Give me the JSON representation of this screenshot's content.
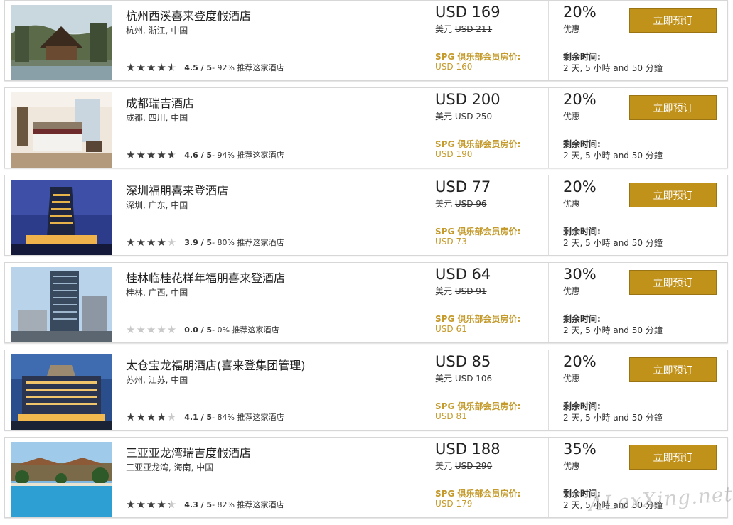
{
  "hotels": [
    {
      "name": "杭州西溪喜来登度假酒店",
      "location": "杭州, 浙江, 中国",
      "rating": 4.5,
      "rating_text": "4.5 / 5",
      "recommend_text": " - 92% 推荐这家酒店",
      "price": "USD 169",
      "old_prefix": "美元 ",
      "old_value": "USD 211",
      "spg_label": "SPG 俱乐部会员房价:",
      "spg_price": "USD 160",
      "discount": "20%",
      "discount_label": "优惠",
      "remaining_label": "剩余时间:",
      "remaining_value": "2 天, 5 小時 and 50 分鐘",
      "button": "立即预订",
      "thumb": "resort"
    },
    {
      "name": "成都瑞吉酒店",
      "location": "成都, 四川, 中国",
      "rating": 4.6,
      "rating_text": "4.6 / 5",
      "recommend_text": " - 94% 推荐这家酒店",
      "price": "USD 200",
      "old_prefix": "美元 ",
      "old_value": "USD 250",
      "spg_label": "SPG 俱乐部会员房价:",
      "spg_price": "USD 190",
      "discount": "20%",
      "discount_label": "优惠",
      "remaining_label": "剩余时间:",
      "remaining_value": "2 天, 5 小時 and 50 分鐘",
      "button": "立即预订",
      "thumb": "room"
    },
    {
      "name": "深圳福朋喜来登酒店",
      "location": "深圳, 广东, 中国",
      "rating": 3.9,
      "rating_text": "3.9 / 5",
      "recommend_text": " - 80% 推荐这家酒店",
      "price": "USD 77",
      "old_prefix": "美元 ",
      "old_value": "USD 96",
      "spg_label": "SPG 俱乐部会员房价:",
      "spg_price": "USD 73",
      "discount": "20%",
      "discount_label": "优惠",
      "remaining_label": "剩余时间:",
      "remaining_value": "2 天, 5 小時 and 50 分鐘",
      "button": "立即预订",
      "thumb": "tower-night"
    },
    {
      "name": "桂林临桂花样年福朋喜来登酒店",
      "location": "桂林, 广西, 中国",
      "rating": 0.0,
      "rating_text": "0.0 / 5",
      "recommend_text": " - 0% 推荐这家酒店",
      "price": "USD 64",
      "old_prefix": "美元 ",
      "old_value": "USD 91",
      "spg_label": "SPG 俱乐部会员房价:",
      "spg_price": "USD 61",
      "discount": "30%",
      "discount_label": "优惠",
      "remaining_label": "剩余时间:",
      "remaining_value": "2 天, 5 小時 and 50 分鐘",
      "button": "立即预订",
      "thumb": "tower-day"
    },
    {
      "name": "太仓宝龙福朋酒店(喜来登集团管理)",
      "location": "苏州, 江苏, 中国",
      "rating": 4.1,
      "rating_text": "4.1 / 5",
      "recommend_text": " - 84% 推荐这家酒店",
      "price": "USD 85",
      "old_prefix": "美元 ",
      "old_value": "USD 106",
      "spg_label": "SPG 俱乐部会员房价:",
      "spg_price": "USD 81",
      "discount": "20%",
      "discount_label": "优惠",
      "remaining_label": "剩余时间:",
      "remaining_value": "2 天, 5 小時 and 50 分鐘",
      "button": "立即预订",
      "thumb": "palace-night"
    },
    {
      "name": "三亚亚龙湾瑞吉度假酒店",
      "location": "三亚亚龙湾, 海南, 中国",
      "rating": 4.3,
      "rating_text": "4.3 / 5",
      "recommend_text": " - 82% 推荐这家酒店",
      "price": "USD 188",
      "old_prefix": "美元 ",
      "old_value": "USD 290",
      "spg_label": "SPG 俱乐部会员房价:",
      "spg_price": "USD 179",
      "discount": "35%",
      "discount_label": "优惠",
      "remaining_label": "剩余时间:",
      "remaining_value": "2 天, 5 小時 and 50 分鐘",
      "button": "立即预订",
      "thumb": "beach-pool"
    }
  ],
  "watermark": "ALexXing.net"
}
